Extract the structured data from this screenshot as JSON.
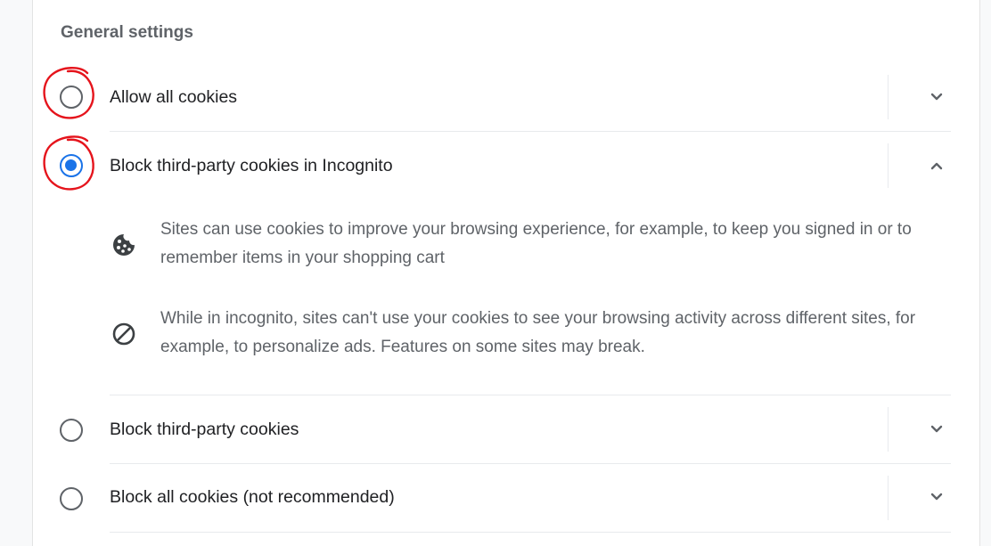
{
  "section_title": "General settings",
  "options": [
    {
      "label": "Allow all cookies",
      "selected": false,
      "expanded": false
    },
    {
      "label": "Block third-party cookies in Incognito",
      "selected": true,
      "expanded": true
    },
    {
      "label": "Block third-party cookies",
      "selected": false,
      "expanded": false
    },
    {
      "label": "Block all cookies (not recommended)",
      "selected": false,
      "expanded": false
    }
  ],
  "details": [
    {
      "icon": "cookie-icon",
      "text": "Sites can use cookies to improve your browsing experience, for example, to keep you signed in or to remember items in your shopping cart"
    },
    {
      "icon": "block-icon",
      "text": "While in incognito, sites can't use your cookies to see your browsing activity across different sites, for example, to personalize ads. Features on some sites may break."
    }
  ],
  "colors": {
    "accent": "#1a73e8",
    "annotation": "#e5141c",
    "text": "#202124",
    "secondary_text": "#5f6368"
  }
}
